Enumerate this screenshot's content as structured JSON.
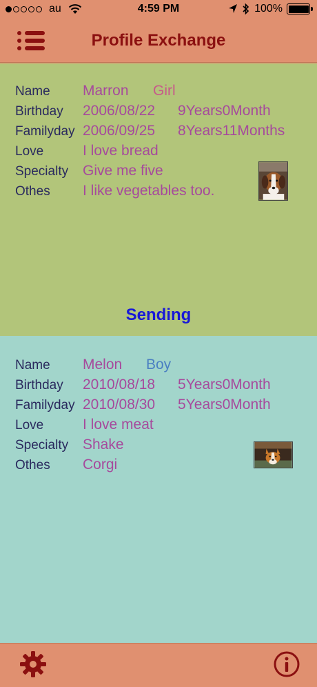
{
  "status_bar": {
    "carrier": "au",
    "time": "4:59 PM",
    "battery": "100%"
  },
  "nav": {
    "title": "Profile Exchange"
  },
  "my_profile": {
    "rows": [
      {
        "label": "Name",
        "value": "Marron",
        "value2": "Girl"
      },
      {
        "label": "Birthday",
        "value": "2006/08/22",
        "value2": "9Years0Month"
      },
      {
        "label": "Familyday",
        "value": "2006/09/25",
        "value2": "8Years11Months"
      },
      {
        "label": "Love",
        "value": "I love bread"
      },
      {
        "label": "Specialty",
        "value": "Give me five"
      },
      {
        "label": "Othes",
        "value": "I like vegetables too."
      }
    ]
  },
  "sending_label": "Sending",
  "received_profile": {
    "rows": [
      {
        "label": "Name",
        "value": "Melon",
        "value2": "Boy"
      },
      {
        "label": "Birthday",
        "value": "2010/08/18",
        "value2": "5Years0Month"
      },
      {
        "label": "Familyday",
        "value": "2010/08/30",
        "value2": "5Years0Month"
      },
      {
        "label": "Love",
        "value": "I love meat"
      },
      {
        "label": "Specialty",
        "value": "Shake"
      },
      {
        "label": "Othes",
        "value": "Corgi"
      }
    ]
  },
  "colors": {
    "bar": "#e09070",
    "top_panel": "#b2c57a",
    "bottom_panel": "#a2d5cb",
    "title": "#8b1010",
    "value": "#a64a9c",
    "label": "#2a2a5e",
    "sending": "#1818d8"
  },
  "icons": {
    "menu": "list-icon",
    "settings": "gear-icon",
    "info": "info-icon"
  }
}
